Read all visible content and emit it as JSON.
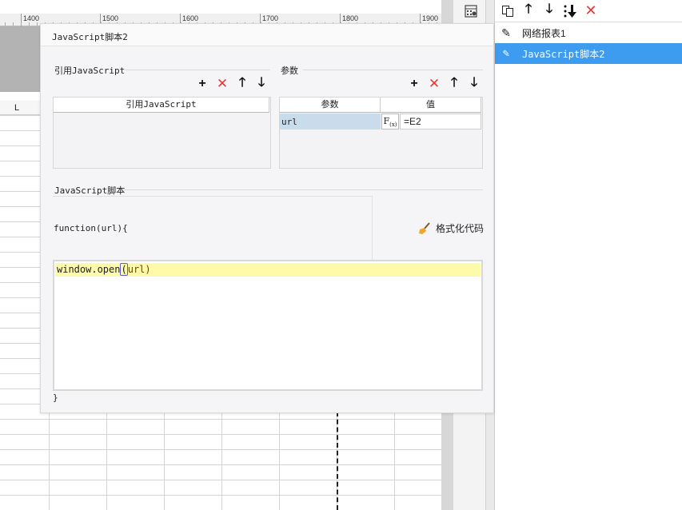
{
  "sheet": {
    "ruler_ticks": [
      "1400",
      "1500",
      "1600",
      "1700",
      "1800",
      "1900"
    ],
    "column_header": "L"
  },
  "right_panel": {
    "items": [
      {
        "label": "网络报表1",
        "icon": "pencil-icon",
        "selected": false
      },
      {
        "label": "JavaScript脚本2",
        "icon": "pencil-icon",
        "selected": true
      }
    ]
  },
  "dialog": {
    "title": "JavaScript脚本2",
    "ref_section": {
      "title": "引用JavaScript",
      "column_header": "引用JavaScript"
    },
    "params_section": {
      "title": "参数",
      "headers": [
        "参数",
        "值"
      ],
      "rows": [
        {
          "name": "url",
          "value": "=E2"
        }
      ],
      "fx_label": "F",
      "fx_sub": "(x)"
    },
    "script_section": {
      "title": "JavaScript脚本",
      "function_header": "function(url){",
      "format_button": "格式化代码",
      "code_prefix": "window.open",
      "code_paren": "(",
      "code_rest": "url)",
      "function_footer": "}"
    }
  },
  "colors": {
    "selection": "#3d9bf0",
    "delete_red": "#e53935",
    "code_highlight": "#fdfaaa",
    "param_cell": "#c9dcec"
  }
}
